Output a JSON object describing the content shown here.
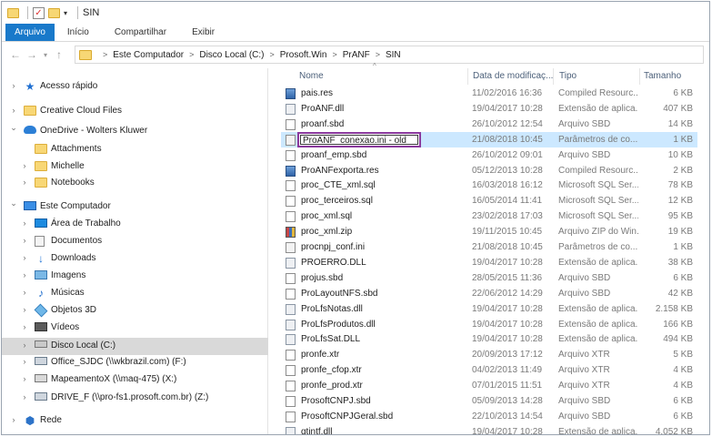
{
  "window": {
    "title": "SIN"
  },
  "ribbon": {
    "tabs": [
      "Arquivo",
      "Início",
      "Compartilhar",
      "Exibir"
    ]
  },
  "address": {
    "crumbs": [
      "Este Computador",
      "Disco Local (C:)",
      "Prosoft.Win",
      "PrANF",
      "SIN"
    ]
  },
  "nav": {
    "items": [
      {
        "label": "Acesso rápido",
        "icon": "star-icon",
        "level": 0,
        "chev": ">"
      },
      {
        "label": "Creative Cloud Files",
        "icon": "folder-icon",
        "level": 0,
        "chev": ">"
      },
      {
        "label": "OneDrive - Wolters Kluwer",
        "icon": "cloud-icon",
        "level": 0,
        "chev": "v"
      },
      {
        "label": "Attachments",
        "icon": "folder-icon",
        "level": 1,
        "chev": ""
      },
      {
        "label": "Michelle",
        "icon": "folder-icon",
        "level": 1,
        "chev": ">"
      },
      {
        "label": "Notebooks",
        "icon": "folder-icon",
        "level": 1,
        "chev": ">"
      },
      {
        "label": "Este Computador",
        "icon": "computer-icon",
        "level": 0,
        "chev": "v"
      },
      {
        "label": "Área de Trabalho",
        "icon": "desktop-icon",
        "level": 1,
        "chev": ">"
      },
      {
        "label": "Documentos",
        "icon": "documents-icon",
        "level": 1,
        "chev": ">"
      },
      {
        "label": "Downloads",
        "icon": "downloads-icon",
        "level": 1,
        "chev": ">"
      },
      {
        "label": "Imagens",
        "icon": "pictures-icon",
        "level": 1,
        "chev": ">"
      },
      {
        "label": "Músicas",
        "icon": "music-icon",
        "level": 1,
        "chev": ">"
      },
      {
        "label": "Objetos 3D",
        "icon": "objects-3d-icon",
        "level": 1,
        "chev": ">"
      },
      {
        "label": "Vídeos",
        "icon": "videos-icon",
        "level": 1,
        "chev": ">"
      },
      {
        "label": "Disco Local (C:)",
        "icon": "local-disk-icon",
        "level": 1,
        "chev": ">",
        "selected": true
      },
      {
        "label": "Office_SJDC (\\\\wkbrazil.com) (F:)",
        "icon": "network-drive-icon",
        "level": 1,
        "chev": ">"
      },
      {
        "label": "MapeamentoX (\\\\maq-475) (X:)",
        "icon": "network-drive-disconnected-icon",
        "level": 1,
        "chev": ">"
      },
      {
        "label": "DRIVE_F (\\\\pro-fs1.prosoft.com.br) (Z:)",
        "icon": "network-drive-icon",
        "level": 1,
        "chev": ">"
      },
      {
        "label": "Rede",
        "icon": "network-icon",
        "level": 0,
        "chev": ">"
      }
    ]
  },
  "columns": {
    "name": "Nome",
    "date": "Data de modificaç...",
    "type": "Tipo",
    "size": "Tamanho"
  },
  "files": [
    {
      "name": "pais.res",
      "date": "11/02/2016 16:36",
      "type": "Compiled Resourc...",
      "size": "6 KB",
      "kind": "res"
    },
    {
      "name": "ProANF.dll",
      "date": "19/04/2017 10:28",
      "type": "Extensão de aplica...",
      "size": "407 KB",
      "kind": "dll"
    },
    {
      "name": "proanf.sbd",
      "date": "26/10/2012 12:54",
      "type": "Arquivo SBD",
      "size": "14 KB",
      "kind": "sbd"
    },
    {
      "name": "ProANF_conexao.ini - old",
      "date": "21/08/2018 10:45",
      "type": "Parâmetros de co...",
      "size": "1 KB",
      "kind": "ini",
      "renaming": true
    },
    {
      "name": "proanf_emp.sbd",
      "date": "26/10/2012 09:01",
      "type": "Arquivo SBD",
      "size": "10 KB",
      "kind": "sbd"
    },
    {
      "name": "ProANFexporta.res",
      "date": "05/12/2013 10:28",
      "type": "Compiled Resourc...",
      "size": "2 KB",
      "kind": "res"
    },
    {
      "name": "proc_CTE_xml.sql",
      "date": "16/03/2018 16:12",
      "type": "Microsoft SQL Ser...",
      "size": "78 KB",
      "kind": "sql"
    },
    {
      "name": "proc_terceiros.sql",
      "date": "16/05/2014 11:41",
      "type": "Microsoft SQL Ser...",
      "size": "12 KB",
      "kind": "sql"
    },
    {
      "name": "proc_xml.sql",
      "date": "23/02/2018 17:03",
      "type": "Microsoft SQL Ser...",
      "size": "95 KB",
      "kind": "sql"
    },
    {
      "name": "proc_xml.zip",
      "date": "19/11/2015 10:45",
      "type": "Arquivo ZIP do Win...",
      "size": "19 KB",
      "kind": "zip"
    },
    {
      "name": "procnpj_conf.ini",
      "date": "21/08/2018 10:45",
      "type": "Parâmetros de co...",
      "size": "1 KB",
      "kind": "ini"
    },
    {
      "name": "PROERRO.DLL",
      "date": "19/04/2017 10:28",
      "type": "Extensão de aplica...",
      "size": "38 KB",
      "kind": "dll"
    },
    {
      "name": "projus.sbd",
      "date": "28/05/2015 11:36",
      "type": "Arquivo SBD",
      "size": "6 KB",
      "kind": "sbd"
    },
    {
      "name": "ProLayoutNFS.sbd",
      "date": "22/06/2012 14:29",
      "type": "Arquivo SBD",
      "size": "42 KB",
      "kind": "sbd"
    },
    {
      "name": "ProLfsNotas.dll",
      "date": "19/04/2017 10:28",
      "type": "Extensão de aplica...",
      "size": "2.158 KB",
      "kind": "dll"
    },
    {
      "name": "ProLfsProdutos.dll",
      "date": "19/04/2017 10:28",
      "type": "Extensão de aplica...",
      "size": "166 KB",
      "kind": "dll"
    },
    {
      "name": "ProLfsSat.DLL",
      "date": "19/04/2017 10:28",
      "type": "Extensão de aplica...",
      "size": "494 KB",
      "kind": "dll"
    },
    {
      "name": "pronfe.xtr",
      "date": "20/09/2013 17:12",
      "type": "Arquivo XTR",
      "size": "5 KB",
      "kind": "xtr"
    },
    {
      "name": "pronfe_cfop.xtr",
      "date": "04/02/2013 11:49",
      "type": "Arquivo XTR",
      "size": "4 KB",
      "kind": "xtr"
    },
    {
      "name": "pronfe_prod.xtr",
      "date": "07/01/2015 11:51",
      "type": "Arquivo XTR",
      "size": "4 KB",
      "kind": "xtr"
    },
    {
      "name": "ProsoftCNPJ.sbd",
      "date": "05/09/2013 14:28",
      "type": "Arquivo SBD",
      "size": "6 KB",
      "kind": "sbd"
    },
    {
      "name": "ProsoftCNPJGeral.sbd",
      "date": "22/10/2013 14:54",
      "type": "Arquivo SBD",
      "size": "6 KB",
      "kind": "sbd"
    },
    {
      "name": "qtintf.dll",
      "date": "19/04/2017 10:28",
      "type": "Extensão de aplica...",
      "size": "4.052 KB",
      "kind": "dll"
    }
  ]
}
